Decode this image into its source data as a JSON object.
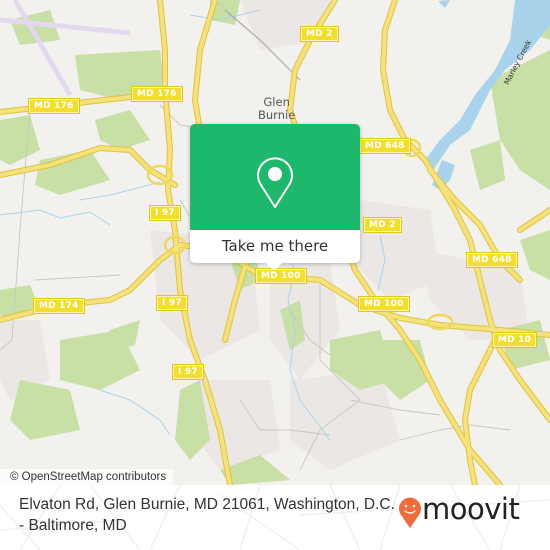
{
  "map": {
    "place_labels": [
      {
        "id": "glen-burnie",
        "text_line1": "Glen",
        "text_line2": "Burnie"
      }
    ],
    "water_labels": [
      {
        "id": "marley-creek",
        "text": "Marley Creek"
      }
    ],
    "road_shields": [
      {
        "id": "md-176-west",
        "text": "MD 176"
      },
      {
        "id": "md-176-east",
        "text": "MD 176"
      },
      {
        "id": "md-2-north",
        "text": "MD 2"
      },
      {
        "id": "md-648-north",
        "text": "MD 648"
      },
      {
        "id": "i-97-north",
        "text": "I 97"
      },
      {
        "id": "md-2-south",
        "text": "MD 2"
      },
      {
        "id": "md-100-center",
        "text": "MD 100"
      },
      {
        "id": "md-648-east",
        "text": "MD 648"
      },
      {
        "id": "md-174",
        "text": "MD 174"
      },
      {
        "id": "i-97-mid",
        "text": "I 97"
      },
      {
        "id": "md-100-east",
        "text": "MD 100"
      },
      {
        "id": "md-10",
        "text": "MD 10"
      },
      {
        "id": "i-97-south",
        "text": "I 97"
      }
    ],
    "attribution": "© OpenStreetMap contributors"
  },
  "popup": {
    "icon": "map-pin-icon",
    "action_label": "Take me there",
    "color": "#1db86b"
  },
  "footer": {
    "address_line1": "Elvaton Rd, Glen Burnie, MD 21061, Washington, D.C.",
    "address_line2": "- Baltimore, MD",
    "logo_text": "moovit",
    "logo_color": "#f26b3a"
  }
}
